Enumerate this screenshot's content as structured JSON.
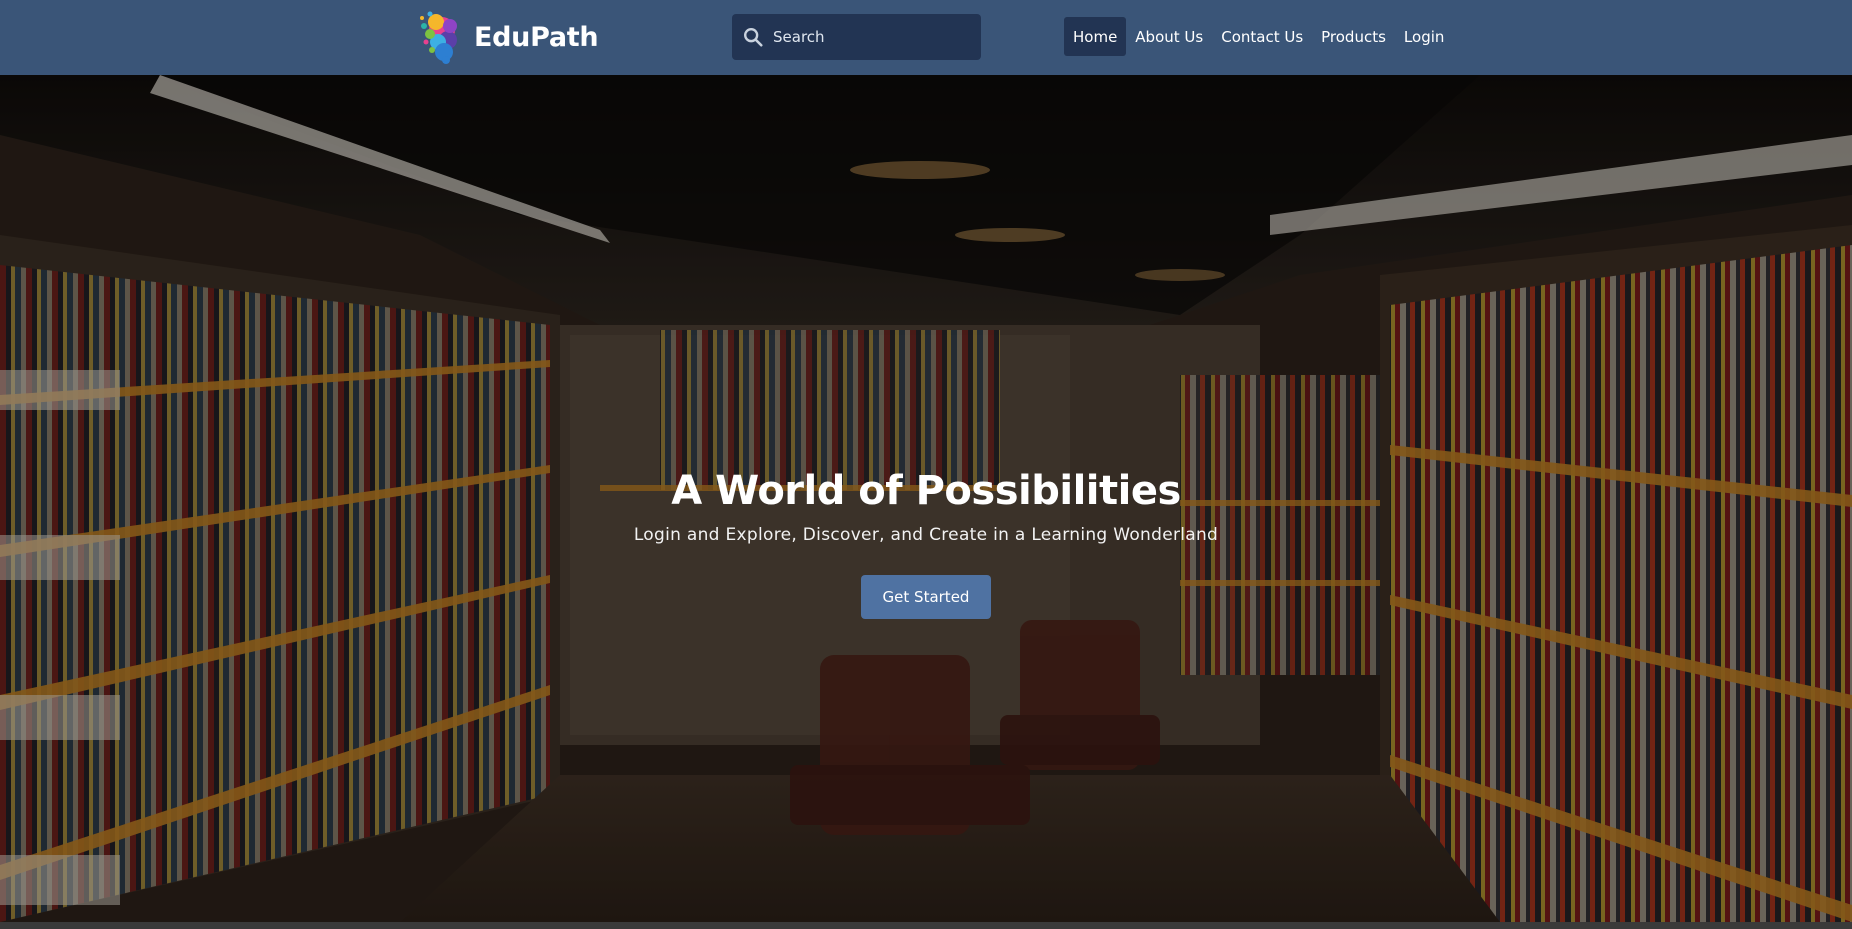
{
  "brand": {
    "name": "EduPath",
    "logo_icon": "colorful-head-logo-icon"
  },
  "search": {
    "placeholder": "Search",
    "value": "",
    "icon": "search-icon"
  },
  "nav": {
    "items": [
      {
        "label": "Home",
        "active": true
      },
      {
        "label": "About Us",
        "active": false
      },
      {
        "label": "Contact Us",
        "active": false
      },
      {
        "label": "Products",
        "active": false
      },
      {
        "label": "Login",
        "active": false
      }
    ]
  },
  "hero": {
    "title": "A World of Possibilities",
    "subtitle": "Login and Explore, Discover, and Create in a Learning Wonderland",
    "cta_label": "Get Started",
    "background": "library-bookshelves-photo"
  },
  "colors": {
    "navbar": "#3a5578",
    "search_bg": "#223453",
    "active_nav_bg": "#223453",
    "cta_bg": "#4f72a2",
    "text": "#ffffff"
  }
}
